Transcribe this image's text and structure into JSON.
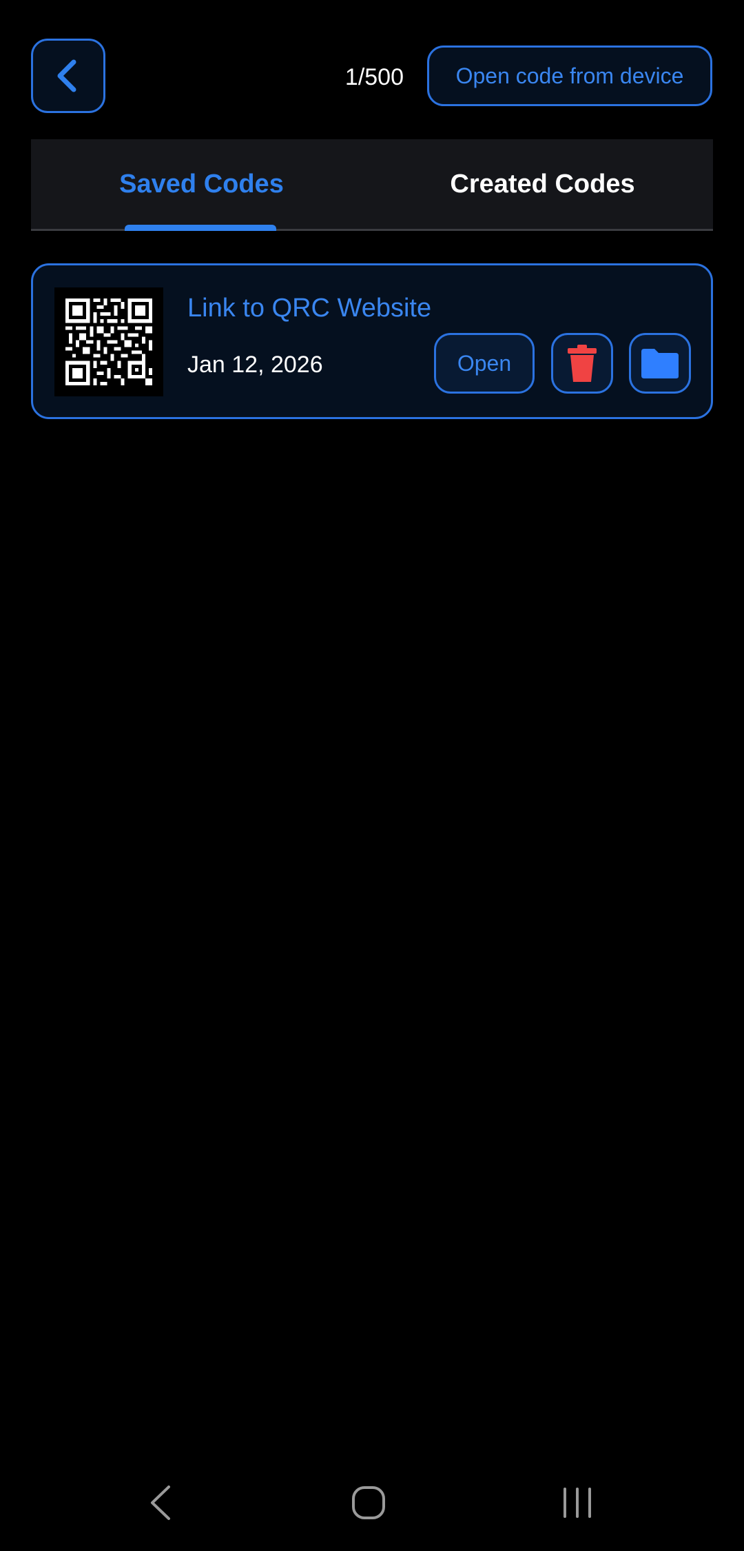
{
  "header": {
    "back_icon": "chevron-left-icon",
    "counter": "1/500",
    "open_device_label": "Open code from device"
  },
  "tabs": [
    {
      "label": "Saved Codes",
      "active": true
    },
    {
      "label": "Created Codes",
      "active": false
    }
  ],
  "codes": [
    {
      "title": "Link to QRC Website",
      "date": "Jan 12, 2026",
      "thumbnail_icon": "qr-code-icon",
      "open_label": "Open",
      "delete_icon": "trash-icon",
      "folder_icon": "folder-icon"
    }
  ],
  "system_nav": {
    "back_icon": "system-back-icon",
    "home_icon": "system-home-icon",
    "recents_icon": "system-recents-icon"
  },
  "colors": {
    "accent": "#2F80ED",
    "border": "#2B72E0",
    "danger": "#F04343",
    "background": "#000000",
    "surface": "#05101F"
  }
}
